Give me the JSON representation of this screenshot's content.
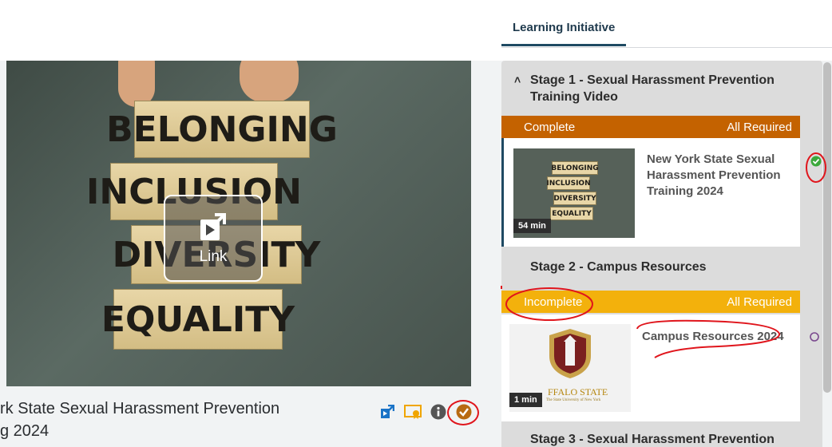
{
  "video": {
    "blocks": [
      "BELONGING",
      "INCLUSION",
      "DIVERSITY",
      "EQUALITY"
    ],
    "link_label": "Link",
    "title_line1": "rk State Sexual Harassment Prevention",
    "title_line2": "g 2024"
  },
  "toolbar": {
    "icons": [
      "external-link-icon",
      "certificate-icon",
      "info-icon",
      "check-complete-icon"
    ]
  },
  "panel": {
    "tab_label": "Learning Initiative",
    "stages": [
      {
        "title": "Stage 1 - Sexual Harassment Prevention Training Video",
        "collapse_glyph": "^",
        "status": "Complete",
        "requirement": "All Required",
        "status_color": "#c46200",
        "item": {
          "title": "New York State Sexual Harassment Prevention Training 2024",
          "duration": "54 min",
          "thumb_blocks": [
            "BELONGING",
            "INCLUSION",
            "DIVERSITY",
            "EQUALITY"
          ]
        }
      },
      {
        "title": "Stage 2 - Campus Resources",
        "status": "Incomplete",
        "requirement": "All Required",
        "status_color": "#f3b10c",
        "item": {
          "title": "Campus Resources 2024",
          "duration": "1 min",
          "logo_text": "FFALO STATE",
          "logo_sub": "The State University of New York"
        }
      },
      {
        "title": "Stage 3 - Sexual Harassment Prevention"
      }
    ]
  }
}
